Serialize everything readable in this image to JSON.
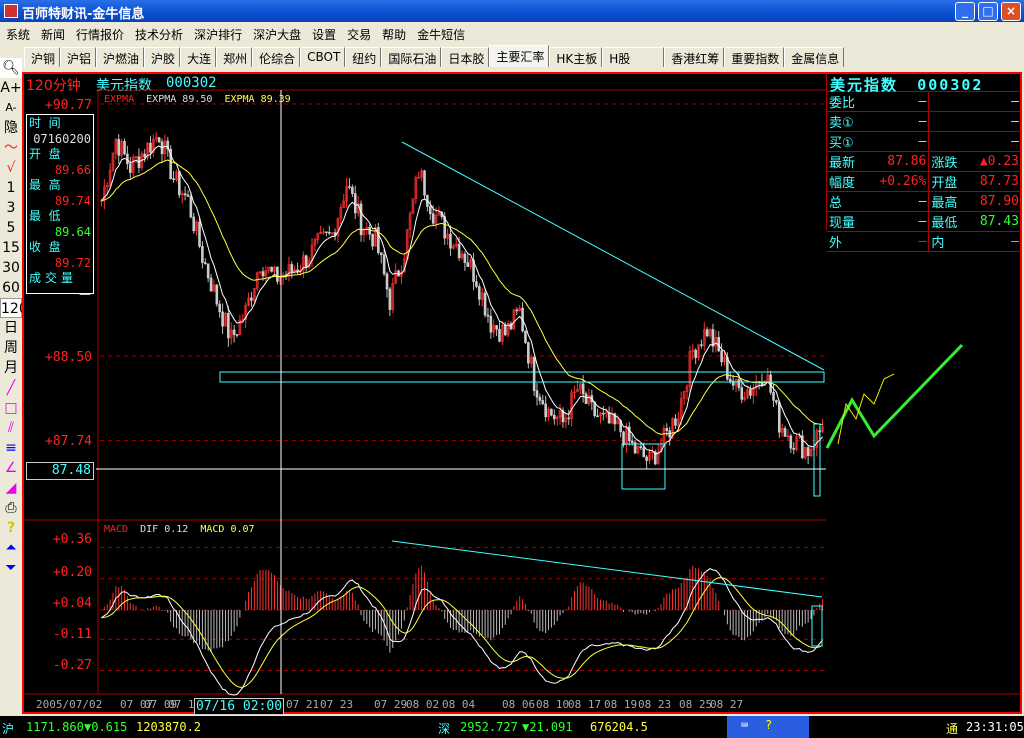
{
  "window": {
    "title": "百师特财讯-金牛信息",
    "min": "_",
    "max": "□",
    "close": "×"
  },
  "menu": [
    "系统",
    "新闻",
    "行情报价",
    "技术分析",
    "深沪排行",
    "深沪大盘",
    "设置",
    "交易",
    "帮助",
    "金牛短信"
  ],
  "tabs": [
    "沪铜",
    "沪铝",
    "沪燃油",
    "沪胶",
    "大连",
    "郑州",
    "伦综合",
    "CBOT",
    "纽约",
    "国际石油",
    "日本胶",
    "主要汇率",
    "HK主板",
    "H股",
    "香港红筹",
    "重要指数",
    "金属信息"
  ],
  "active_tab": "主要汇率",
  "toolbar": [
    "A+",
    "A-",
    "隐",
    "1",
    "3",
    "5",
    "15",
    "30",
    "60",
    "120",
    "日",
    "周",
    "月"
  ],
  "chart": {
    "period": "120分钟",
    "name": "美元指数",
    "code": "000302",
    "indicator": {
      "label": "EXPMA",
      "l1": "EXPMA",
      "v1": "89.50",
      "l2": "EXPMA",
      "v2": "89.39"
    },
    "price_labels": [
      "+90.77",
      "+88.50",
      "+87.74"
    ],
    "cursor_price": "87.48",
    "macd": {
      "label": "MACD",
      "dif_label": "DIF",
      "dif": "0.12",
      "macd_label": "MACD",
      "macd": "0.07",
      "levels": [
        "+0.36",
        "+0.20",
        "+0.04",
        "-0.11",
        "-0.27"
      ]
    },
    "dates": [
      "2005/07/02",
      "07 07",
      "07 09",
      "07 19",
      "07 21",
      "07 23",
      "07 29",
      "08 02",
      "08 04",
      "08 06",
      "08 10",
      "08 17",
      "08 19",
      "08 23",
      "08 25",
      "08 27"
    ],
    "cursor_date": "07/16 02:00"
  },
  "tooltip": {
    "time_label": "时  间",
    "time": "07160200",
    "open_label": "开  盘",
    "open": "89.66",
    "high_label": "最  高",
    "high": "89.74",
    "low_label": "最  低",
    "low": "89.64",
    "close_label": "收  盘",
    "close": "89.72",
    "vol_label": "成交量",
    "vol": "—"
  },
  "quote": {
    "title": "美元指数",
    "code": "000302",
    "rows": [
      [
        "委比",
        "—",
        "",
        "—"
      ],
      [
        "卖①",
        "—",
        "",
        "—"
      ],
      [
        "买①",
        "—",
        "",
        "—"
      ],
      [
        "最新",
        "87.86",
        "涨跌",
        "▲0.23"
      ],
      [
        "幅度",
        "+0.26%",
        "开盘",
        "87.73"
      ],
      [
        "总",
        "—",
        "最高",
        "87.90"
      ],
      [
        "现量",
        "—",
        "最低",
        "87.43"
      ],
      [
        "外",
        "—",
        "内",
        "—"
      ]
    ]
  },
  "status": {
    "sh_label": "沪",
    "sh_index": "1171.860",
    "sh_change": "▼0.615",
    "sh_amount": "1203870.2",
    "sz_label": "深",
    "sz_index": "2952.727",
    "sz_change": "▼21.091",
    "sz_amount": "676204.5",
    "tong": "通",
    "time": "23:31:05"
  },
  "chart_data": {
    "type": "candlestick",
    "title": "美元指数 000302 120分钟",
    "ylim": [
      87.02,
      90.9
    ],
    "closes": [
      89.9,
      90.45,
      90.2,
      90.35,
      90.5,
      90.1,
      89.9,
      89.4,
      89.0,
      88.65,
      88.9,
      89.35,
      89.2,
      89.25,
      89.35,
      89.5,
      89.6,
      90.05,
      89.7,
      89.55,
      89.0,
      89.45,
      90.17,
      89.8,
      89.6,
      89.45,
      89.2,
      88.8,
      88.7,
      88.9,
      88.28,
      88.0,
      87.9,
      88.2,
      88.0,
      87.9,
      87.83,
      87.65,
      87.55,
      87.74,
      88.0,
      88.55,
      88.74,
      88.47,
      88.2,
      88.2,
      88.37,
      87.9,
      87.74,
      87.65,
      87.86
    ],
    "colors": {
      "up": "#ff3030",
      "down": "#ffffff",
      "ema_fast": "#ffffff",
      "ema_slow": "#ffff40",
      "trend": "#40ffff"
    }
  }
}
